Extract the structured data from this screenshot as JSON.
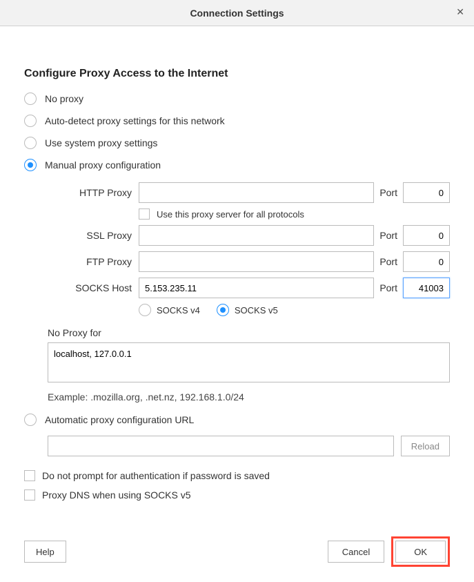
{
  "titlebar": {
    "title": "Connection Settings",
    "close": "✕"
  },
  "heading": "Configure Proxy Access to the Internet",
  "options": {
    "no_proxy": "No proxy",
    "auto_detect": "Auto-detect proxy settings for this network",
    "system_proxy": "Use system proxy settings",
    "manual": "Manual proxy configuration",
    "auto_url": "Automatic proxy configuration URL"
  },
  "proxy": {
    "http_label": "HTTP Proxy",
    "http_value": "",
    "http_port": "0",
    "use_for_all": "Use this proxy server for all protocols",
    "ssl_label": "SSL Proxy",
    "ssl_value": "",
    "ssl_port": "0",
    "ftp_label": "FTP Proxy",
    "ftp_value": "",
    "ftp_port": "0",
    "socks_label": "SOCKS Host",
    "socks_value": "5.153.235.11",
    "socks_port": "41003",
    "port_label": "Port",
    "socks_v4": "SOCKS v4",
    "socks_v5": "SOCKS v5"
  },
  "noproxy": {
    "label": "No Proxy for",
    "value": "localhost, 127.0.0.1",
    "example": "Example: .mozilla.org, .net.nz, 192.168.1.0/24"
  },
  "auto_url": {
    "value": "",
    "reload": "Reload"
  },
  "checks": {
    "no_prompt_auth": "Do not prompt for authentication if password is saved",
    "proxy_dns_socks5": "Proxy DNS when using SOCKS v5"
  },
  "footer": {
    "help": "Help",
    "cancel": "Cancel",
    "ok": "OK"
  }
}
